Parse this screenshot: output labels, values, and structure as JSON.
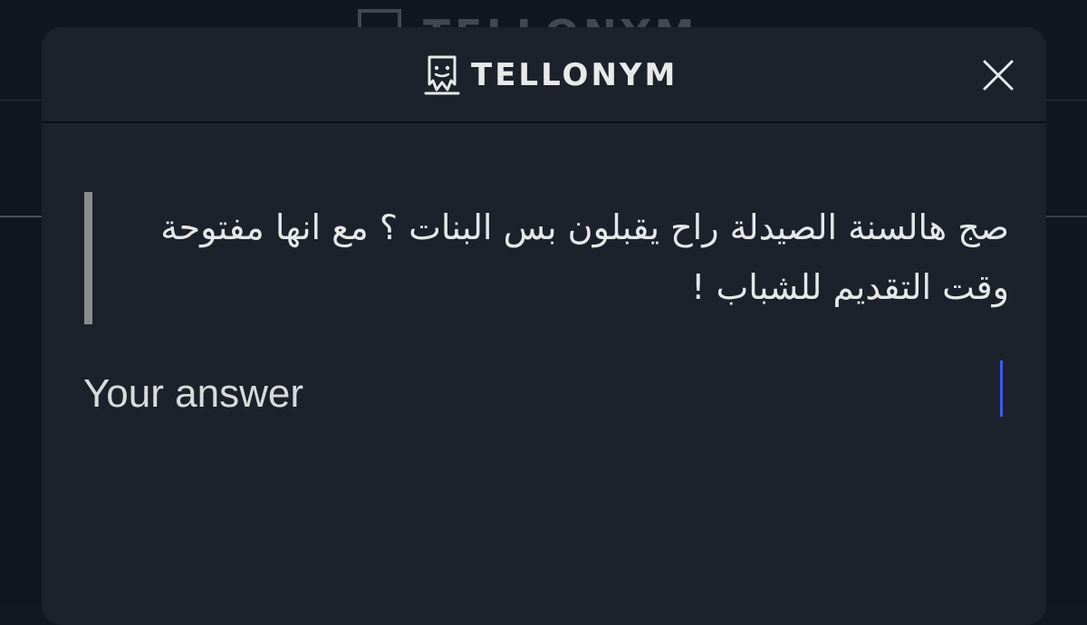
{
  "app": {
    "brand": "TELLONYM"
  },
  "icons": {
    "logo": "tellonym-face-icon",
    "close": "close-icon"
  },
  "tell": {
    "text": "صج هالسنة الصيدلة راح يقبلون بس البنات ؟ مع انها مفتوحة وقت التقديم للشباب !"
  },
  "answer": {
    "placeholder": "Your answer",
    "value": ""
  },
  "colors": {
    "background": "#12161e",
    "modal": "#1c212b",
    "text": "#e6e7e9",
    "quote_bar": "#8a8c90",
    "caret": "#3d5ee8"
  }
}
